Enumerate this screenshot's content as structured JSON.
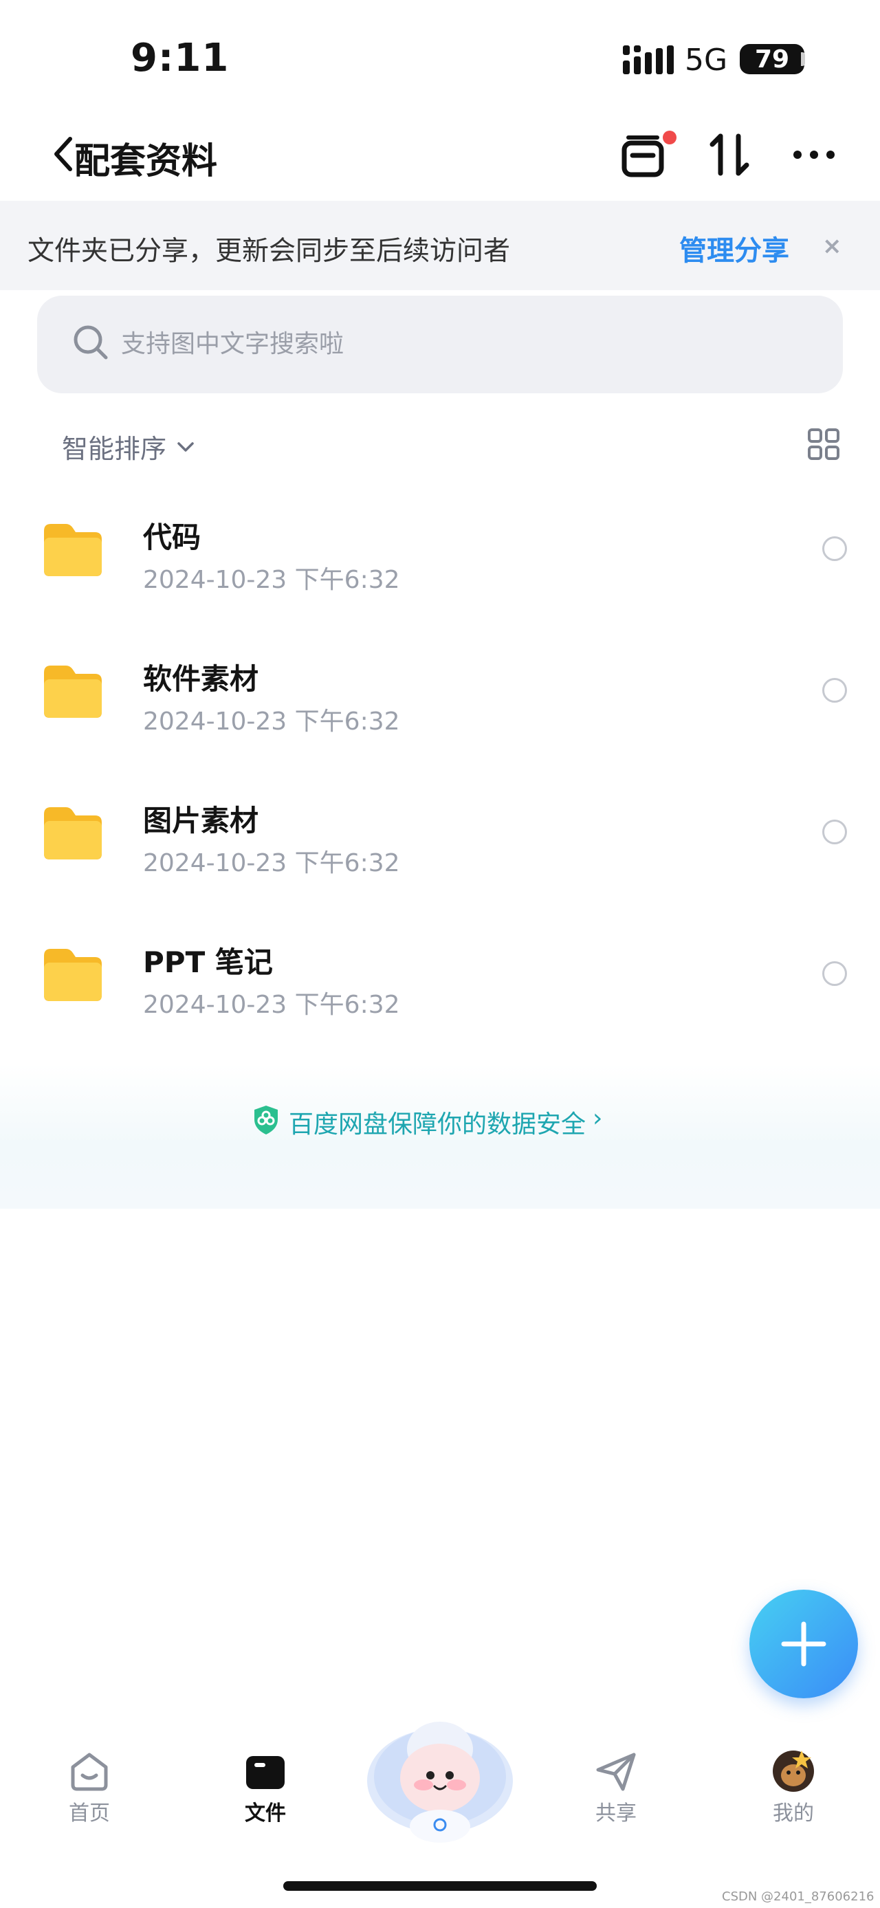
{
  "status_bar": {
    "time": "9:11",
    "network": "5G",
    "battery": "79"
  },
  "nav": {
    "title": "配套资料"
  },
  "share_banner": {
    "text": "文件夹已分享，更新会同步至后续访问者",
    "manage_label": "管理分享",
    "close_label": "×"
  },
  "search": {
    "placeholder": "支持图中文字搜索啦"
  },
  "sort": {
    "label": "智能排序"
  },
  "files": [
    {
      "name": "代码",
      "date": "2024-10-23 下午6:32"
    },
    {
      "name": "软件素材",
      "date": "2024-10-23 下午6:32"
    },
    {
      "name": "图片素材",
      "date": "2024-10-23 下午6:32"
    },
    {
      "name": "PPT 笔记",
      "date": "2024-10-23 下午6:32"
    }
  ],
  "security": {
    "text": "百度网盘保障你的数据安全",
    "chevron": "›"
  },
  "tabs": [
    {
      "label": "首页",
      "icon": "home-icon"
    },
    {
      "label": "文件",
      "icon": "folder-icon",
      "active": true
    },
    {
      "label": "共享",
      "icon": "send-icon"
    },
    {
      "label": "我的",
      "icon": "avatar"
    }
  ],
  "watermark": "CSDN @2401_87606216",
  "colors": {
    "accent": "#2d8cf0",
    "security": "#1ea6b0",
    "folder": "#f8c43a",
    "badge": "#f04a4a"
  }
}
